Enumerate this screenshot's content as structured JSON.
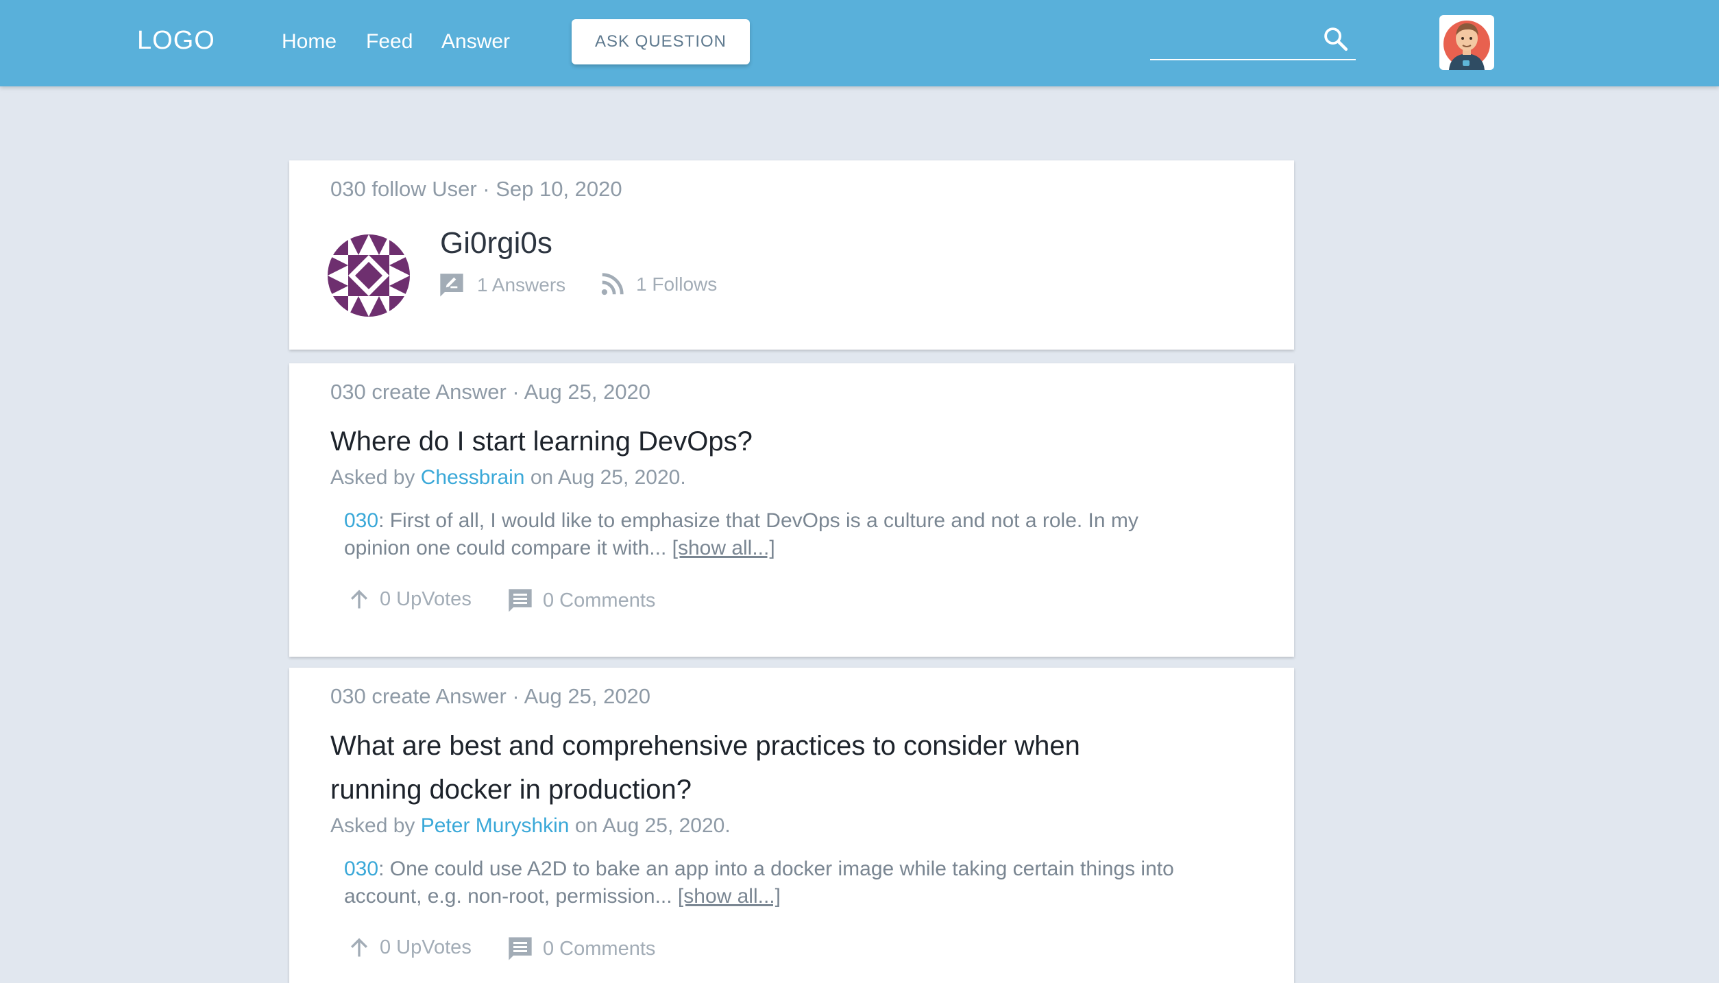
{
  "header": {
    "logo": "LOGO",
    "nav": [
      "Home",
      "Feed",
      "Answer"
    ],
    "ask_button": "ASK QUESTION",
    "search_placeholder": "",
    "accent_color": "#59b0da"
  },
  "profile_card": {
    "meta": "030 follow User · Sep 10, 2020",
    "name": "Gi0rgi0s",
    "answers": "1 Answers",
    "follows": "1 Follows"
  },
  "feed": [
    {
      "meta": "030 create Answer · Aug 25, 2020",
      "title": "Where do I start learning DevOps?",
      "asked_prefix": "Asked by ",
      "asker": "Chessbrain",
      "asked_suffix": " on Aug 25, 2020.",
      "author": "030",
      "excerpt": ": First of all, I would like to emphasize that DevOps is a culture and not a role. In my opinion one could compare it with... ",
      "show_all": "[show all...]",
      "upvotes": "0 UpVotes",
      "comments": "0 Comments"
    },
    {
      "meta": "030 create Answer · Aug 25, 2020",
      "title": "What are best and comprehensive practices to consider when running docker in production?",
      "asked_prefix": "Asked by ",
      "asker": "Peter Muryshkin",
      "asked_suffix": " on Aug 25, 2020.",
      "author": "030",
      "excerpt": ": One could use A2D to bake an app into a docker image while taking certain things into account, e.g. non-root, permission... ",
      "show_all": "[show all...]",
      "upvotes": "0 UpVotes",
      "comments": "0 Comments"
    }
  ]
}
